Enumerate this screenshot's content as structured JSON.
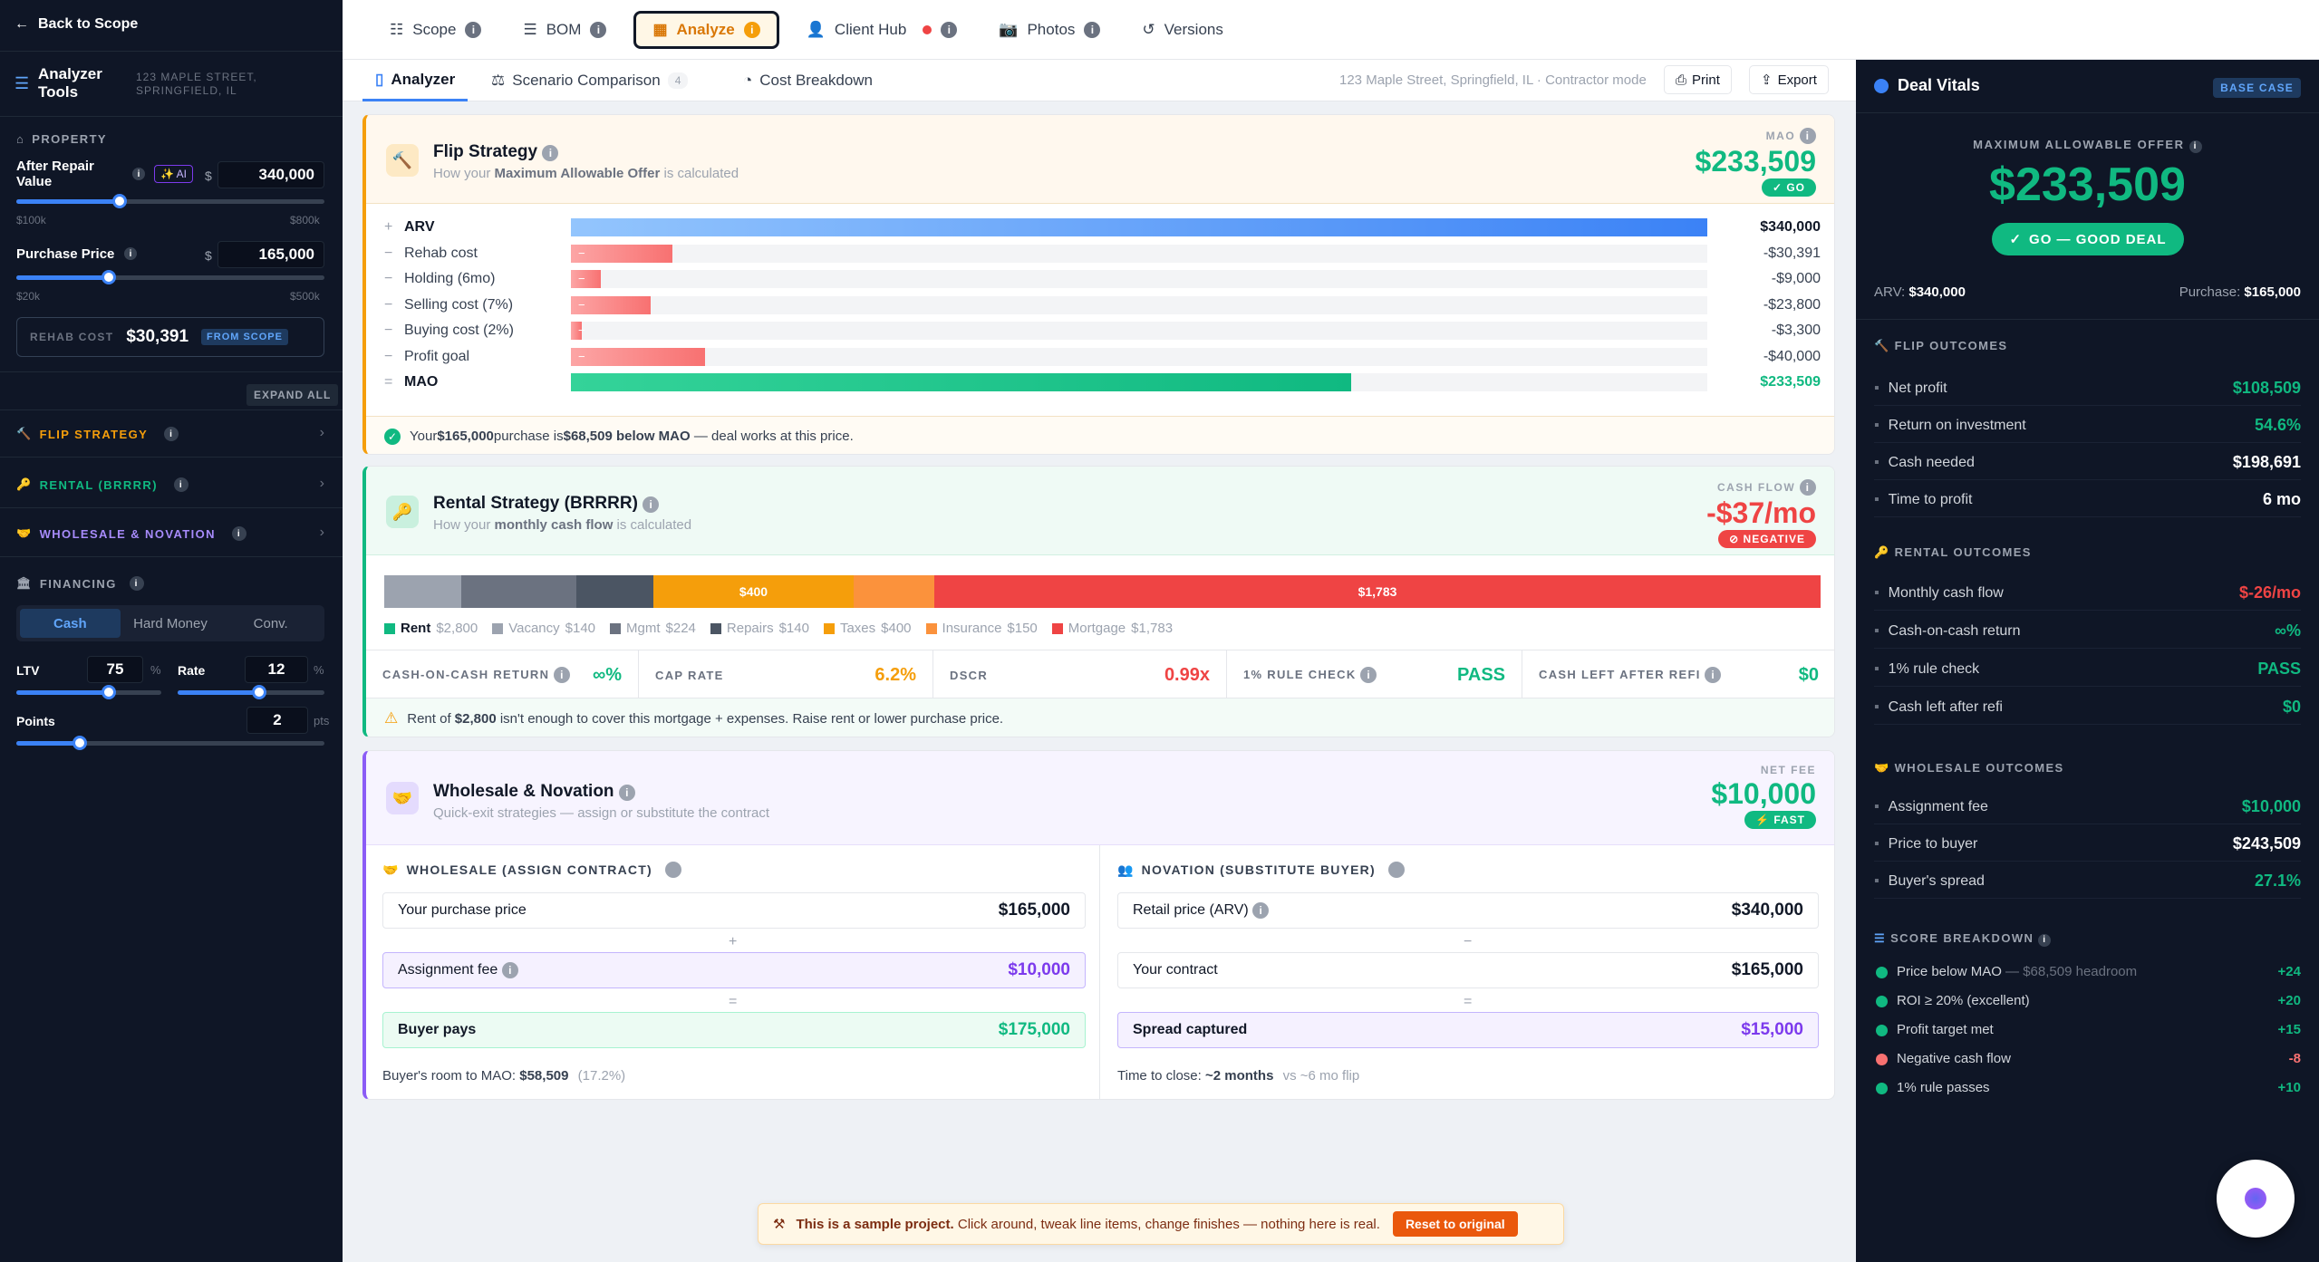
{
  "left_sidebar": {
    "back_label": "Back to Scope",
    "tools_title": "Analyzer Tools",
    "address": "123 MAPLE STREET, SPRINGFIELD, IL",
    "property_section": "PROPERTY",
    "arv_label": "After Repair Value",
    "ai_badge": "✨ AI",
    "dollar": "$",
    "arv_value": "340,000",
    "arv_slider_fraction": 0.21,
    "arv_min": "$100k",
    "arv_max": "$800k",
    "purchase_label": "Purchase Price",
    "purchase_value": "165,000",
    "purchase_min": "$20k",
    "purchase_max": "$500k",
    "rehab_label": "REHAB COST",
    "rehab_value": "$30,391",
    "from_scope": "FROM SCOPE",
    "expand_all": "EXPAND ALL",
    "flip_strategy": "FLIP STRATEGY",
    "rental_strategy": "RENTAL (BRRRR)",
    "wholesale": "WHOLESALE & NOVATION",
    "financing": "FINANCING",
    "fin_tabs": [
      "Cash",
      "Hard Money",
      "Conv."
    ],
    "ltv_label": "LTV",
    "ltv_value": "75",
    "pct": "%",
    "rate_label": "Rate",
    "rate_value": "12",
    "points_label": "Points",
    "points_value": "2",
    "pts": "pts"
  },
  "top_tabs": [
    {
      "label": "Scope"
    },
    {
      "label": "BOM"
    },
    {
      "label": "Analyze"
    },
    {
      "label": "Client Hub"
    },
    {
      "label": "Photos"
    },
    {
      "label": "Versions"
    }
  ],
  "sub_tabs": {
    "analyzer": "Analyzer",
    "scenario": "Scenario Comparison",
    "scenario_count": "4",
    "cost": "Cost Breakdown",
    "context": "123 Maple Street, Springfield, IL · Contractor mode",
    "print": "Print",
    "export": "Export"
  },
  "flip": {
    "title": "Flip Strategy",
    "subtitle_pre": "How your ",
    "subtitle_bold": "Maximum Allowable Offer",
    "subtitle_post": " is calculated",
    "mao_label": "MAO",
    "mao_value": "$233,509",
    "badge": "GO",
    "rows": [
      {
        "sign": "+",
        "label": "ARV",
        "amount": "$340,000"
      },
      {
        "sign": "−",
        "label": "Rehab cost",
        "amount": "-$30,391"
      },
      {
        "sign": "−",
        "label": "Holding (6mo)",
        "amount": "-$9,000"
      },
      {
        "sign": "−",
        "label": "Selling cost (7%)",
        "amount": "-$23,800"
      },
      {
        "sign": "−",
        "label": "Buying cost (2%)",
        "amount": "-$3,300"
      },
      {
        "sign": "−",
        "label": "Profit goal",
        "amount": "-$40,000"
      },
      {
        "sign": "=",
        "label": "MAO",
        "amount": "$233,509"
      }
    ],
    "note_pre": "Your ",
    "note_b1": "$165,000",
    "note_mid": " purchase is ",
    "note_b2": "$68,509 below MAO",
    "note_post": " — deal works at this price."
  },
  "rental": {
    "title": "Rental Strategy (BRRRR)",
    "subtitle_pre": "How your ",
    "subtitle_bold": "monthly cash flow",
    "subtitle_post": " is calculated",
    "cf_label": "CASH FLOW",
    "cf_value": "-$37/mo",
    "badge": "NEGATIVE",
    "seg_400": "$400",
    "seg_1783": "$1,783",
    "legend": [
      {
        "name": "Rent",
        "value": "$2,800",
        "color": "#10b981"
      },
      {
        "name": "Vacancy",
        "value": "$140",
        "color": "#9ca3af"
      },
      {
        "name": "Mgmt",
        "value": "$224",
        "color": "#6b7280"
      },
      {
        "name": "Repairs",
        "value": "$140",
        "color": "#4b5563"
      },
      {
        "name": "Taxes",
        "value": "$400",
        "color": "#f59e0b"
      },
      {
        "name": "Insurance",
        "value": "$150",
        "color": "#fb923c"
      },
      {
        "name": "Mortgage",
        "value": "$1,783",
        "color": "#ef4444"
      }
    ],
    "metrics": [
      {
        "label": "CASH-ON-CASH RETURN",
        "value": "∞%"
      },
      {
        "label": "CAP RATE",
        "value": "6.2%"
      },
      {
        "label": "DSCR",
        "value": "0.99x"
      },
      {
        "label": "1% RULE CHECK",
        "value": "PASS"
      },
      {
        "label": "CASH LEFT AFTER REFI",
        "value": "$0"
      }
    ],
    "warn_pre": "Rent of ",
    "warn_b": "$2,800",
    "warn_post": " isn't enough to cover this mortgage + expenses. Raise rent or lower purchase price."
  },
  "wholesale": {
    "title": "Wholesale & Novation",
    "subtitle": "Quick-exit strategies — assign or substitute the contract",
    "fee_label": "NET FEE",
    "fee_value": "$10,000",
    "badge": "⚡ FAST",
    "left_title": "WHOLESALE (ASSIGN CONTRACT)",
    "l_purchase_label": "Your purchase price",
    "l_purchase": "$165,000",
    "plus": "+",
    "l_fee_label": "Assignment fee",
    "l_fee": "$10,000",
    "equals": "=",
    "l_buyer_label": "Buyer pays",
    "l_buyer": "$175,000",
    "l_note_pre": "Buyer's room to MAO: ",
    "l_note_b": "$58,509",
    "l_note_post": "(17.2%)",
    "right_title": "NOVATION (SUBSTITUTE BUYER)",
    "r_retail_label": "Retail price (ARV)",
    "r_retail": "$340,000",
    "minus": "−",
    "r_contract_label": "Your contract",
    "r_contract": "$165,000",
    "r_spread_label": "Spread captured",
    "r_spread": "$15,000",
    "r_note_pre": "Time to close: ",
    "r_note_b": "~2 months",
    "r_note_post": "vs ~6 mo flip"
  },
  "toast": {
    "bold": "This is a sample project.",
    "text": " Click around, tweak line items, change finishes — nothing here is real.",
    "button": "Reset to original"
  },
  "deal_vitals": {
    "title": "Deal Vitals",
    "base_case": "BASE CASE",
    "mao_label": "MAXIMUM ALLOWABLE OFFER",
    "mao_value": "$233,509",
    "go_badge": "GO — GOOD DEAL",
    "arv_label": "ARV:",
    "arv_value": "$340,000",
    "purchase_label": "Purchase:",
    "purchase_value": "$165,000",
    "flip_title": "FLIP OUTCOMES",
    "flip_rows": [
      {
        "label": "Net profit",
        "value": "$108,509",
        "color": "#10b981"
      },
      {
        "label": "Return on investment",
        "value": "54.6%",
        "color": "#10b981"
      },
      {
        "label": "Cash needed",
        "value": "$198,691",
        "color": "#ffffff"
      },
      {
        "label": "Time to profit",
        "value": "6 mo",
        "color": "#ffffff"
      }
    ],
    "rental_title": "RENTAL OUTCOMES",
    "rental_rows": [
      {
        "label": "Monthly cash flow",
        "value": "$-26/mo",
        "color": "#ef4444"
      },
      {
        "label": "Cash-on-cash return",
        "value": "∞%",
        "color": "#10b981"
      },
      {
        "label": "1% rule check",
        "value": "PASS",
        "color": "#10b981"
      },
      {
        "label": "Cash left after refi",
        "value": "$0",
        "color": "#10b981"
      }
    ],
    "wholesale_title": "WHOLESALE OUTCOMES",
    "wholesale_rows": [
      {
        "label": "Assignment fee",
        "value": "$10,000",
        "color": "#10b981"
      },
      {
        "label": "Price to buyer",
        "value": "$243,509",
        "color": "#ffffff"
      },
      {
        "label": "Buyer's spread",
        "value": "27.1%",
        "color": "#10b981"
      }
    ],
    "score_title": "SCORE BREAKDOWN",
    "score_rows": [
      {
        "label": "Price below MAO",
        "extra": " — $68,509 headroom",
        "value": "+24",
        "color": "#10b981"
      },
      {
        "label": "ROI ≥ 20% (excellent)",
        "extra": "",
        "value": "+20",
        "color": "#10b981"
      },
      {
        "label": "Profit target met",
        "extra": "",
        "value": "+15",
        "color": "#10b981"
      },
      {
        "label": "Negative cash flow",
        "extra": "",
        "value": "-8",
        "color": "#f87171"
      },
      {
        "label": "1% rule passes",
        "extra": "",
        "value": "+10",
        "color": "#10b981"
      }
    ]
  }
}
